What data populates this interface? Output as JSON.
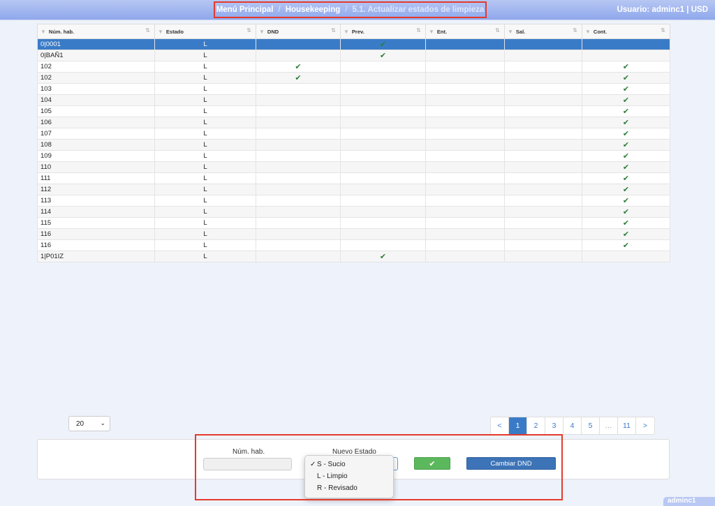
{
  "header": {
    "breadcrumb": [
      "Menú Principal",
      "Housekeeping",
      "5.1. Actualizar estados de limpieza"
    ],
    "separator": "/",
    "user_info": "Usuario: adminc1 | USD"
  },
  "table": {
    "columns": [
      "Núm. hab.",
      "Estado",
      "DND",
      "Prev.",
      "Ent.",
      "Sal.",
      "Cont."
    ],
    "rows": [
      {
        "room": "0|0001",
        "estado": "L",
        "dnd": false,
        "prev": true,
        "ent": false,
        "sal": false,
        "cont": false,
        "selected": true
      },
      {
        "room": "0|BAÑ1",
        "estado": "L",
        "dnd": false,
        "prev": true,
        "ent": false,
        "sal": false,
        "cont": false
      },
      {
        "room": "102",
        "estado": "L",
        "dnd": true,
        "prev": false,
        "ent": false,
        "sal": false,
        "cont": true
      },
      {
        "room": "102",
        "estado": "L",
        "dnd": true,
        "prev": false,
        "ent": false,
        "sal": false,
        "cont": true
      },
      {
        "room": "103",
        "estado": "L",
        "dnd": false,
        "prev": false,
        "ent": false,
        "sal": false,
        "cont": true
      },
      {
        "room": "104",
        "estado": "L",
        "dnd": false,
        "prev": false,
        "ent": false,
        "sal": false,
        "cont": true
      },
      {
        "room": "105",
        "estado": "L",
        "dnd": false,
        "prev": false,
        "ent": false,
        "sal": false,
        "cont": true
      },
      {
        "room": "106",
        "estado": "L",
        "dnd": false,
        "prev": false,
        "ent": false,
        "sal": false,
        "cont": true
      },
      {
        "room": "107",
        "estado": "L",
        "dnd": false,
        "prev": false,
        "ent": false,
        "sal": false,
        "cont": true
      },
      {
        "room": "108",
        "estado": "L",
        "dnd": false,
        "prev": false,
        "ent": false,
        "sal": false,
        "cont": true
      },
      {
        "room": "109",
        "estado": "L",
        "dnd": false,
        "prev": false,
        "ent": false,
        "sal": false,
        "cont": true
      },
      {
        "room": "110",
        "estado": "L",
        "dnd": false,
        "prev": false,
        "ent": false,
        "sal": false,
        "cont": true
      },
      {
        "room": "111",
        "estado": "L",
        "dnd": false,
        "prev": false,
        "ent": false,
        "sal": false,
        "cont": true
      },
      {
        "room": "112",
        "estado": "L",
        "dnd": false,
        "prev": false,
        "ent": false,
        "sal": false,
        "cont": true
      },
      {
        "room": "113",
        "estado": "L",
        "dnd": false,
        "prev": false,
        "ent": false,
        "sal": false,
        "cont": true
      },
      {
        "room": "114",
        "estado": "L",
        "dnd": false,
        "prev": false,
        "ent": false,
        "sal": false,
        "cont": true
      },
      {
        "room": "115",
        "estado": "L",
        "dnd": false,
        "prev": false,
        "ent": false,
        "sal": false,
        "cont": true
      },
      {
        "room": "116",
        "estado": "L",
        "dnd": false,
        "prev": false,
        "ent": false,
        "sal": false,
        "cont": true
      },
      {
        "room": "116",
        "estado": "L",
        "dnd": false,
        "prev": false,
        "ent": false,
        "sal": false,
        "cont": true
      },
      {
        "room": "1|P01IZ",
        "estado": "L",
        "dnd": false,
        "prev": true,
        "ent": false,
        "sal": false,
        "cont": false
      }
    ],
    "check_glyph": "✔"
  },
  "pager": {
    "page_size": "20",
    "pages": [
      "<",
      "1",
      "2",
      "3",
      "4",
      "5",
      "…",
      "11",
      ">"
    ],
    "active": "1"
  },
  "form": {
    "room_label": "Núm. hab.",
    "room_value": "",
    "estado_label": "Nuevo Estado",
    "options": [
      {
        "label": "S - Sucio",
        "selected": true
      },
      {
        "label": "L - Limpio",
        "selected": false
      },
      {
        "label": "R - Revisado",
        "selected": false
      }
    ],
    "selected_mark": "✓",
    "confirm_glyph": "✔",
    "dnd_button": "Cambiar DND"
  },
  "footer": {
    "user": "adminc1"
  },
  "colors": {
    "accent": "#3a7bc7",
    "check": "#2f7d3a",
    "confirm": "#5cb85c",
    "highlight": "#e53a2b"
  }
}
